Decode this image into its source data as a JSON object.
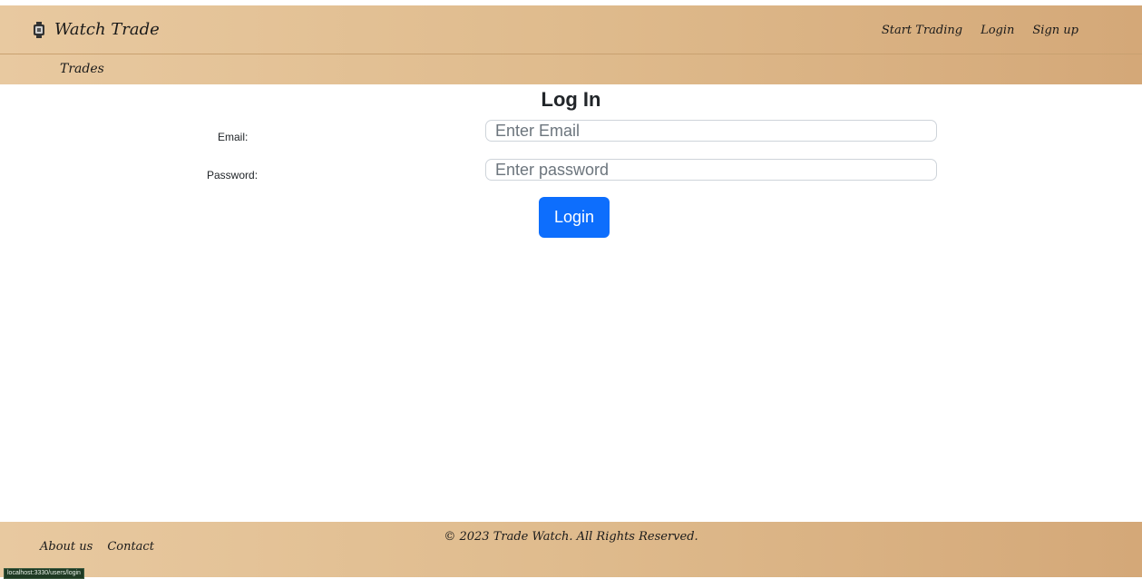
{
  "navbar": {
    "brand": "Watch Trade",
    "links": [
      "Start Trading",
      "Login",
      "Sign up"
    ]
  },
  "subnav": {
    "trades": "Trades"
  },
  "form": {
    "title": "Log In",
    "email_label": "Email:",
    "email_placeholder": "Enter Email",
    "password_label": "Password:",
    "password_placeholder": "Enter password",
    "submit_label": "Login"
  },
  "footer": {
    "links": [
      "About us",
      "Contact"
    ],
    "copyright": "© 2023 Trade Watch. All Rights Reserved."
  },
  "status_bar": {
    "url": "localhost:3330/users/login"
  },
  "colors": {
    "primary": "#0d6efd",
    "header_start": "#e8c9a0",
    "header_end": "#d4a878"
  },
  "icons": {
    "brand": "watch-icon"
  }
}
